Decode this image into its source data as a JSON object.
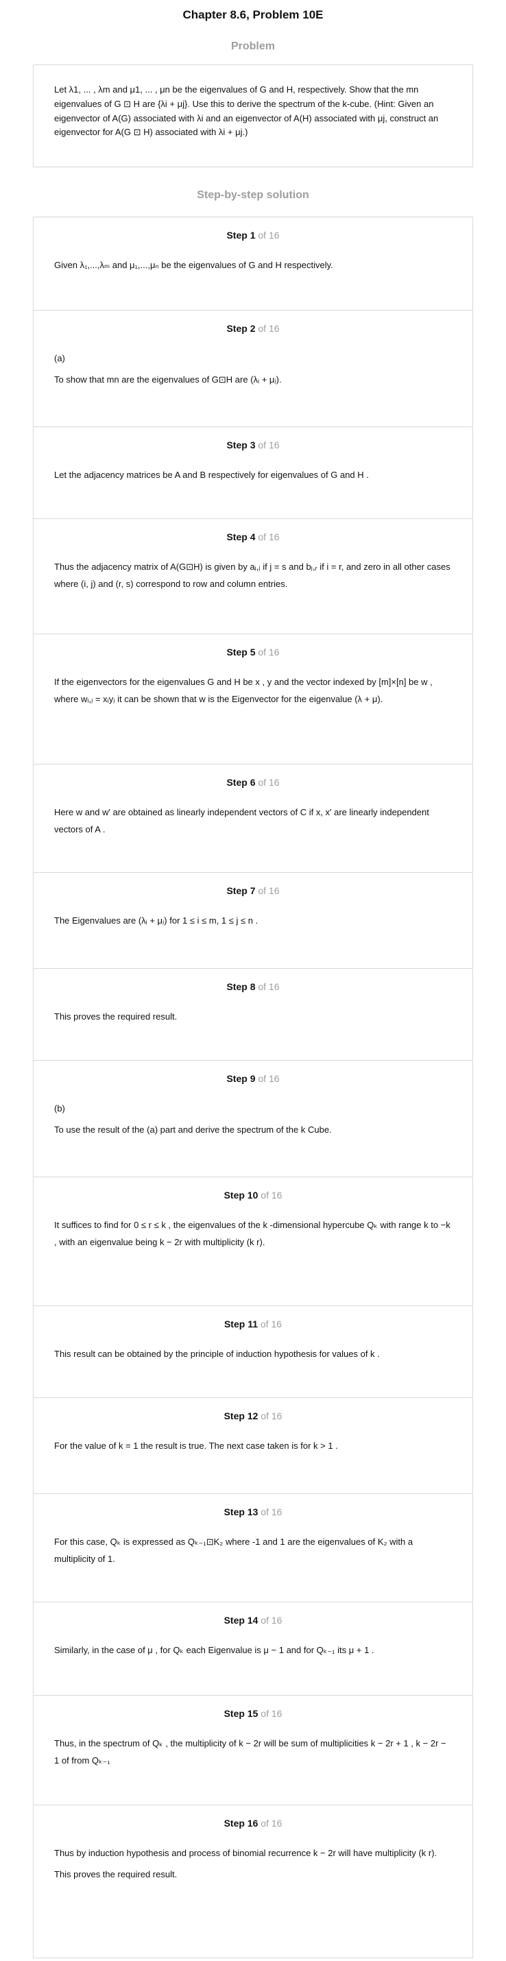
{
  "header": {
    "chapter_title": "Chapter 8.6, Problem 10E",
    "problem_heading": "Problem",
    "solution_heading": "Step-by-step solution"
  },
  "problem": {
    "text": "Let λ1, ... , λm and μ1, ... , μn be the eigenvalues of G and H, respectively. Show that the mn eigenvalues of G ⊡ H are {λi + μj}. Use this to derive the spectrum of the k-cube. (Hint: Given an eigenvector of A(G) associated with λi and an eigenvector of A(H) associated with μj, construct an eigenvector for A(G ⊡ H) associated with λi + μj.)"
  },
  "of_total": "of 16",
  "steps": [
    {
      "label": "Step 1",
      "lines": [
        "Given  λ₁,...,λₘ and  μ₁,...,μₙ be the eigenvalues of  G  and  H  respectively."
      ]
    },
    {
      "label": "Step 2",
      "lines": [
        "(a)",
        "To show that  mn are the eigenvalues of  G⊡H are (λᵢ + μⱼ)."
      ]
    },
    {
      "label": "Step 3",
      "lines": [
        "Let the adjacency matrices be  A  and  B respectively for eigenvalues of  G  and  H ."
      ]
    },
    {
      "label": "Step 4",
      "lines": [
        "Thus the adjacency matrix of  A(G⊡H) is given by aᵢ,ⱼ if  j = s and  bⱼ,ᵣ  if  i = r, and zero in all other cases where  (i, j)  and  (r, s)  correspond to row and column entries."
      ]
    },
    {
      "label": "Step 5",
      "lines": [
        "If the eigenvectors for the eigenvalues  G  and H be  x ,  y  and the vector indexed by [m]×[n] be  w , where  wᵢ,ⱼ = xᵢyⱼ  it can be shown that  w is the Eigenvector for the eigenvalue (λ + μ)."
      ]
    },
    {
      "label": "Step 6",
      "lines": [
        "Here  w and  w′ are obtained as linearly independent vectors of  C if  x, x′ are linearly independent vectors of  A ."
      ]
    },
    {
      "label": "Step 7",
      "lines": [
        "The Eigenvalues are  (λᵢ + μⱼ) for 1 ≤ i ≤ m, 1 ≤ j ≤ n ."
      ]
    },
    {
      "label": "Step 8",
      "lines": [
        "This proves the required result."
      ]
    },
    {
      "label": "Step 9",
      "lines": [
        "(b)",
        "To use the result of the (a) part and derive the spectrum of the  k Cube."
      ]
    },
    {
      "label": "Step 10",
      "lines": [
        "It suffices to find for  0 ≤ r ≤ k , the eigenvalues of the  k -dimensional hypercube  Qₖ with range  k  to  −k , with an eigenvalue being  k − 2r with multiplicity (k r)."
      ]
    },
    {
      "label": "Step 11",
      "lines": [
        "This result can be obtained by the principle of induction hypothesis for values of  k ."
      ]
    },
    {
      "label": "Step 12",
      "lines": [
        "For the value of  k = 1 the result is true. The next case taken is for  k > 1 ."
      ]
    },
    {
      "label": "Step 13",
      "lines": [
        "For this case,  Qₖ is expressed as  Qₖ₋₁⊡K₂ where -1 and 1 are the eigenvalues of  K₂ with a multiplicity of 1."
      ]
    },
    {
      "label": "Step 14",
      "lines": [
        "Similarly, in the case of  μ , for  Qₖ each Eigenvalue is  μ − 1 and for  Qₖ₋₁ its  μ + 1 ."
      ]
    },
    {
      "label": "Step 15",
      "lines": [
        "Thus, in the spectrum of  Qₖ , the multiplicity of  k − 2r will be sum of multiplicities  k − 2r + 1 ,  k − 2r − 1 of from  Qₖ₋₁"
      ]
    },
    {
      "label": "Step 16",
      "lines": [
        "Thus by induction hypothesis and process of binomial recurrence  k − 2r will have multiplicity (k r).",
        "This proves the required result."
      ]
    }
  ]
}
